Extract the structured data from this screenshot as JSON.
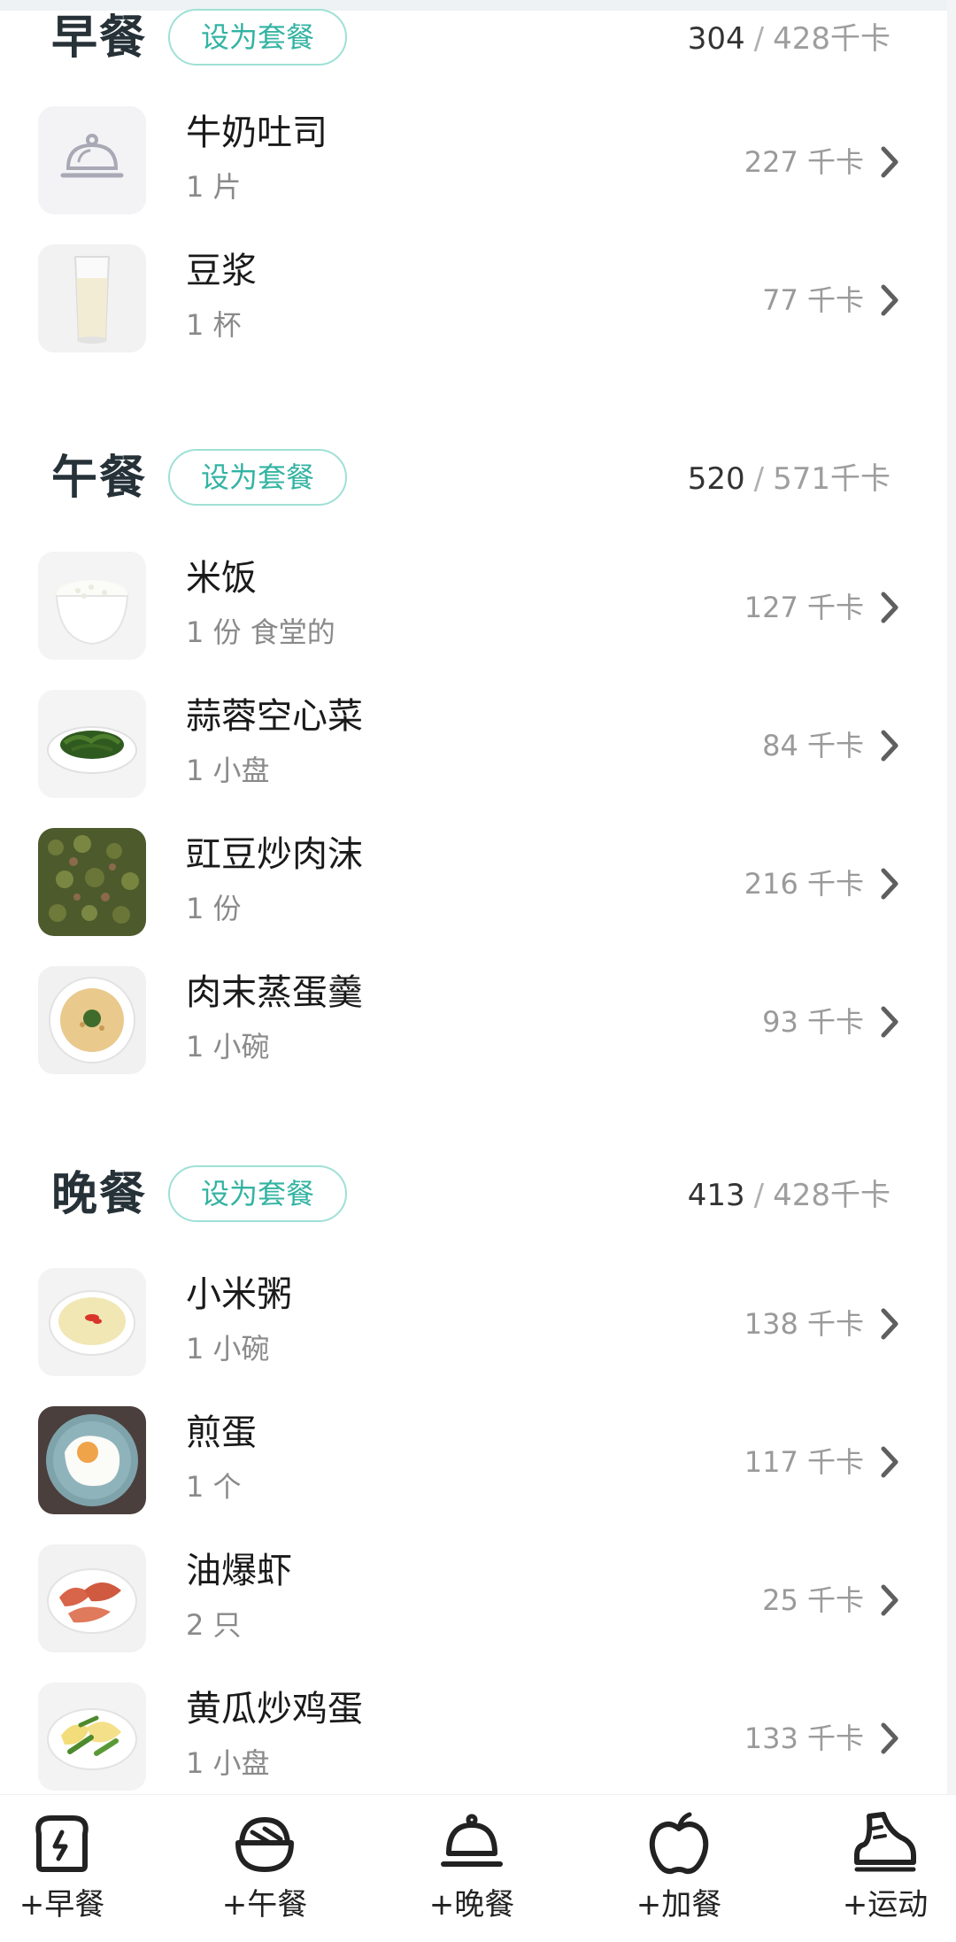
{
  "breakfast": {
    "title": "早餐",
    "combo_label": "设为套餐",
    "eaten": "304",
    "separator": "/",
    "target": "428千卡",
    "items": [
      {
        "name": "牛奶吐司",
        "portion": "1 片",
        "calories": "227 千卡",
        "icon": "dish-cover-icon"
      },
      {
        "name": "豆浆",
        "portion": "1 杯",
        "calories": "77 千卡",
        "icon": "soy-milk-glass"
      }
    ]
  },
  "lunch": {
    "title": "午餐",
    "combo_label": "设为套餐",
    "eaten": "520",
    "separator": "/",
    "target": "571千卡",
    "items": [
      {
        "name": "米饭",
        "portion": "1 份 食堂的",
        "calories": "127 千卡",
        "icon": "rice-bowl"
      },
      {
        "name": "蒜蓉空心菜",
        "portion": "1 小盘",
        "calories": "84 千卡",
        "icon": "greens-plate"
      },
      {
        "name": "豇豆炒肉沫",
        "portion": "1 份",
        "calories": "216 千卡",
        "icon": "beans-minced-meat"
      },
      {
        "name": "肉末蒸蛋羹",
        "portion": "1 小碗",
        "calories": "93 千卡",
        "icon": "steamed-egg-bowl"
      }
    ]
  },
  "dinner": {
    "title": "晚餐",
    "combo_label": "设为套餐",
    "eaten": "413",
    "separator": "/",
    "target": "428千卡",
    "items": [
      {
        "name": "小米粥",
        "portion": "1 小碗",
        "calories": "138 千卡",
        "icon": "millet-porridge"
      },
      {
        "name": "煎蛋",
        "portion": "1 个",
        "calories": "117 千卡",
        "icon": "fried-egg-plate"
      },
      {
        "name": "油爆虾",
        "portion": "2 只",
        "calories": "25 千卡",
        "icon": "fried-shrimp"
      },
      {
        "name": "黄瓜炒鸡蛋",
        "portion": "1 小盘",
        "calories": "133 千卡",
        "icon": "cucumber-egg"
      }
    ]
  },
  "tabbar": {
    "breakfast": "+早餐",
    "lunch": "+午餐",
    "dinner": "+晚餐",
    "snack": "+加餐",
    "exercise": "+运动"
  },
  "colors": {
    "accent": "#33b3a2",
    "accent_border": "#9fe0d6",
    "title": "#263238",
    "muted": "#9a9a9a"
  }
}
